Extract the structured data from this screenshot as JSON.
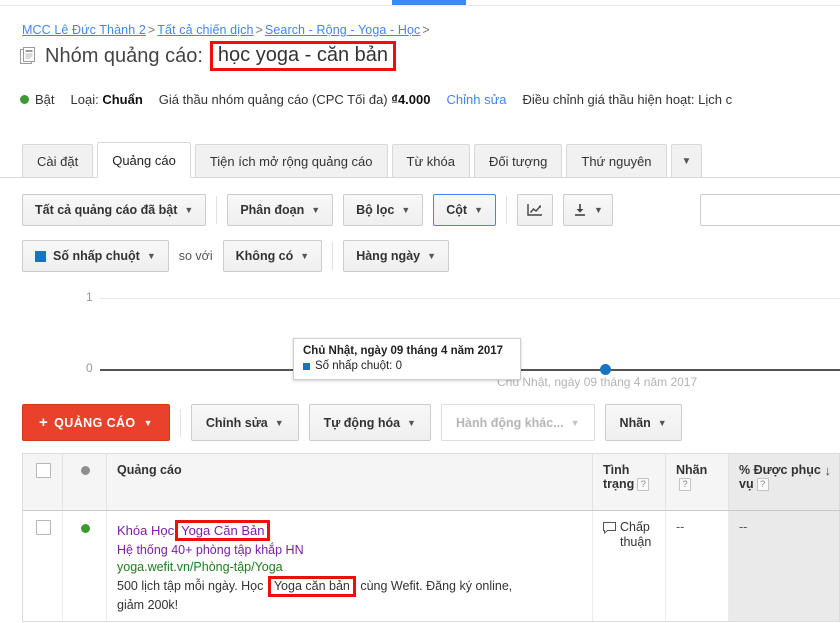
{
  "breadcrumb": {
    "items": [
      "MCC Lê Đức Thành 2",
      "Tất cả chiến dịch",
      "Search - Rộng - Yoga - Học"
    ],
    "separator": ">",
    "trailing": ">"
  },
  "header": {
    "icon": "adgroup-icon",
    "title_label": "Nhóm quảng cáo:",
    "title_value": "học yoga - căn bản",
    "highlight_color": "#f20d0d"
  },
  "status_bar": {
    "state": "Bật",
    "state_color": "#3a9b33",
    "type_label": "Loại:",
    "type_value": "Chuẩn",
    "bid_label": "Giá thầu nhóm quảng cáo (CPC Tối đa)",
    "bid_currency": "₫",
    "bid_value": "4.000",
    "edit_link": "Chỉnh sửa",
    "adjust_label": "Điều chỉnh giá thầu hiện hoạt: Lịch c"
  },
  "tabs": [
    {
      "label": "Cài đặt",
      "active": false
    },
    {
      "label": "Quảng cáo",
      "active": true
    },
    {
      "label": "Tiện ích mở rộng quảng cáo",
      "active": false
    },
    {
      "label": "Từ khóa",
      "active": false
    },
    {
      "label": "Đối tượng",
      "active": false
    },
    {
      "label": "Thứ nguyên",
      "active": false
    }
  ],
  "tabs_overflow_icon": "chevron-down-icon",
  "toolbar_primary": {
    "filter_all_ads": "Tất cả quảng cáo đã bật",
    "segment": "Phân đoạn",
    "filters": "Bộ lọc",
    "columns": "Cột",
    "columns_selected": true,
    "chart_icon": "line-chart-icon",
    "download_icon": "download-icon",
    "search_value": "",
    "search_placeholder": ""
  },
  "toolbar_metrics": {
    "metric": "Số nhấp chuột",
    "metric_color": "#1a73c0",
    "compare_label": "so với",
    "compare_value": "Không có",
    "granularity": "Hàng ngày"
  },
  "chart_data": {
    "type": "line",
    "title": "",
    "xlabel": "",
    "ylabel": "",
    "categories": [
      "Chủ Nhật, ngày 09 tháng 4 năm 2017"
    ],
    "series": [
      {
        "name": "Số nhấp chuột",
        "values": [
          0
        ],
        "color": "#1a73c0"
      }
    ],
    "ylim": [
      0,
      1
    ],
    "yticks": [
      "0",
      "1"
    ],
    "grid": true,
    "legend": "none",
    "x_tick_label": "Chủ Nhật, ngày 09 tháng 4 năm 2017",
    "tooltip": {
      "title": "Chủ Nhật, ngày 09 tháng 4 năm 2017",
      "series_label": "Số nhấp chuột:",
      "series_value": "0"
    }
  },
  "action_bar": {
    "new_ad": "QUẢNG CÁO",
    "new_ad_plus": "+",
    "edit": "Chỉnh sửa",
    "automate": "Tự động hóa",
    "more_actions": "Hành động khác...",
    "more_actions_disabled": true,
    "labels": "Nhãn"
  },
  "table": {
    "headers": {
      "status_dot": "",
      "ad": "Quảng cáo",
      "state": "Tình trạng",
      "label": "Nhãn",
      "served": "% Được phục vụ",
      "help_marker": "?",
      "sort_arrow": "↓"
    },
    "rows": [
      {
        "selected": false,
        "state_dot_color": "#3a9b33",
        "headline": "Khóa Học ",
        "headline_highlight": "Yoga Căn Bản",
        "line2": "Hệ thống 40+ phòng tập khắp HN",
        "url": "yoga.wefit.vn/Phòng-tập/Yoga",
        "desc_before": "500 lịch tập mỗi ngày. Học ",
        "desc_highlight": "Yoga căn bản",
        "desc_after": " cùng Wefit. Đăng ký online, giảm 200k!",
        "status": "Chấp thuận",
        "status_icon": "speech-bubble-icon",
        "label_value": "--",
        "served_value": "--"
      }
    ]
  }
}
